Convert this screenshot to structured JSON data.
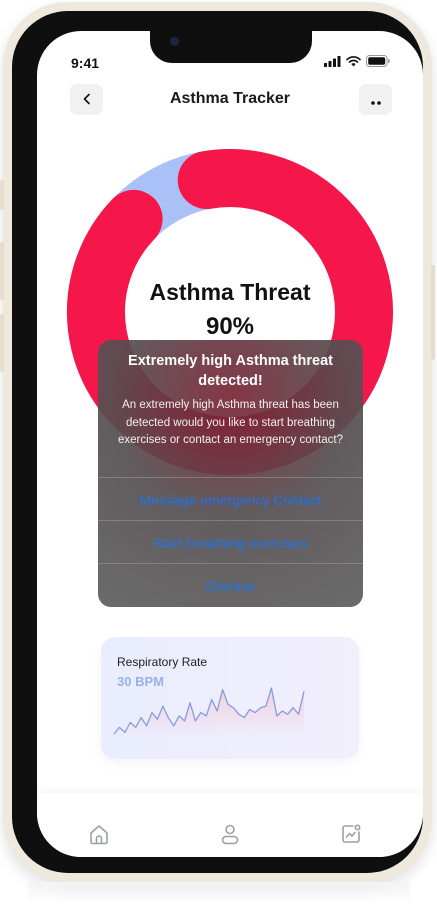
{
  "status_bar": {
    "time": "9:41",
    "icons": [
      "signal-icon",
      "wifi-icon",
      "battery-icon"
    ]
  },
  "header": {
    "title": "Asthma Tracker",
    "back_icon": "chevron-left-icon",
    "more_icon": "more-dots-icon"
  },
  "threat": {
    "label": "Asthma Threat",
    "value_text": "90%",
    "value": 0.9,
    "colors": {
      "threat": "#f5174a",
      "remaining": "#a9c1f6"
    }
  },
  "alert": {
    "title": "Extremely high Asthma threat detected!",
    "message": "An extremely high Asthma threat has been detected would you like to start breathing exercises or contact an emergency contact?",
    "actions": [
      {
        "label": "Message emergency Contact"
      },
      {
        "label": "Start breathing exercises"
      },
      {
        "label": "Dismiss"
      }
    ],
    "action_color": "#1677ff"
  },
  "respiratory": {
    "label": "Respiratory Rate",
    "value_text": "30 BPM",
    "series": [
      8,
      12,
      9,
      15,
      12,
      18,
      13,
      21,
      17,
      25,
      18,
      13,
      19,
      16,
      27,
      16,
      21,
      19,
      29,
      22,
      35,
      26,
      24,
      20,
      18,
      23,
      21,
      24,
      25,
      36,
      19,
      22,
      20,
      24,
      20,
      34
    ],
    "line_color": "#8a9bdc"
  },
  "bottom_nav": [
    {
      "name": "nav-home",
      "icon": "home-icon"
    },
    {
      "name": "nav-profile",
      "icon": "user-icon"
    },
    {
      "name": "nav-stats",
      "icon": "chart-icon"
    }
  ]
}
